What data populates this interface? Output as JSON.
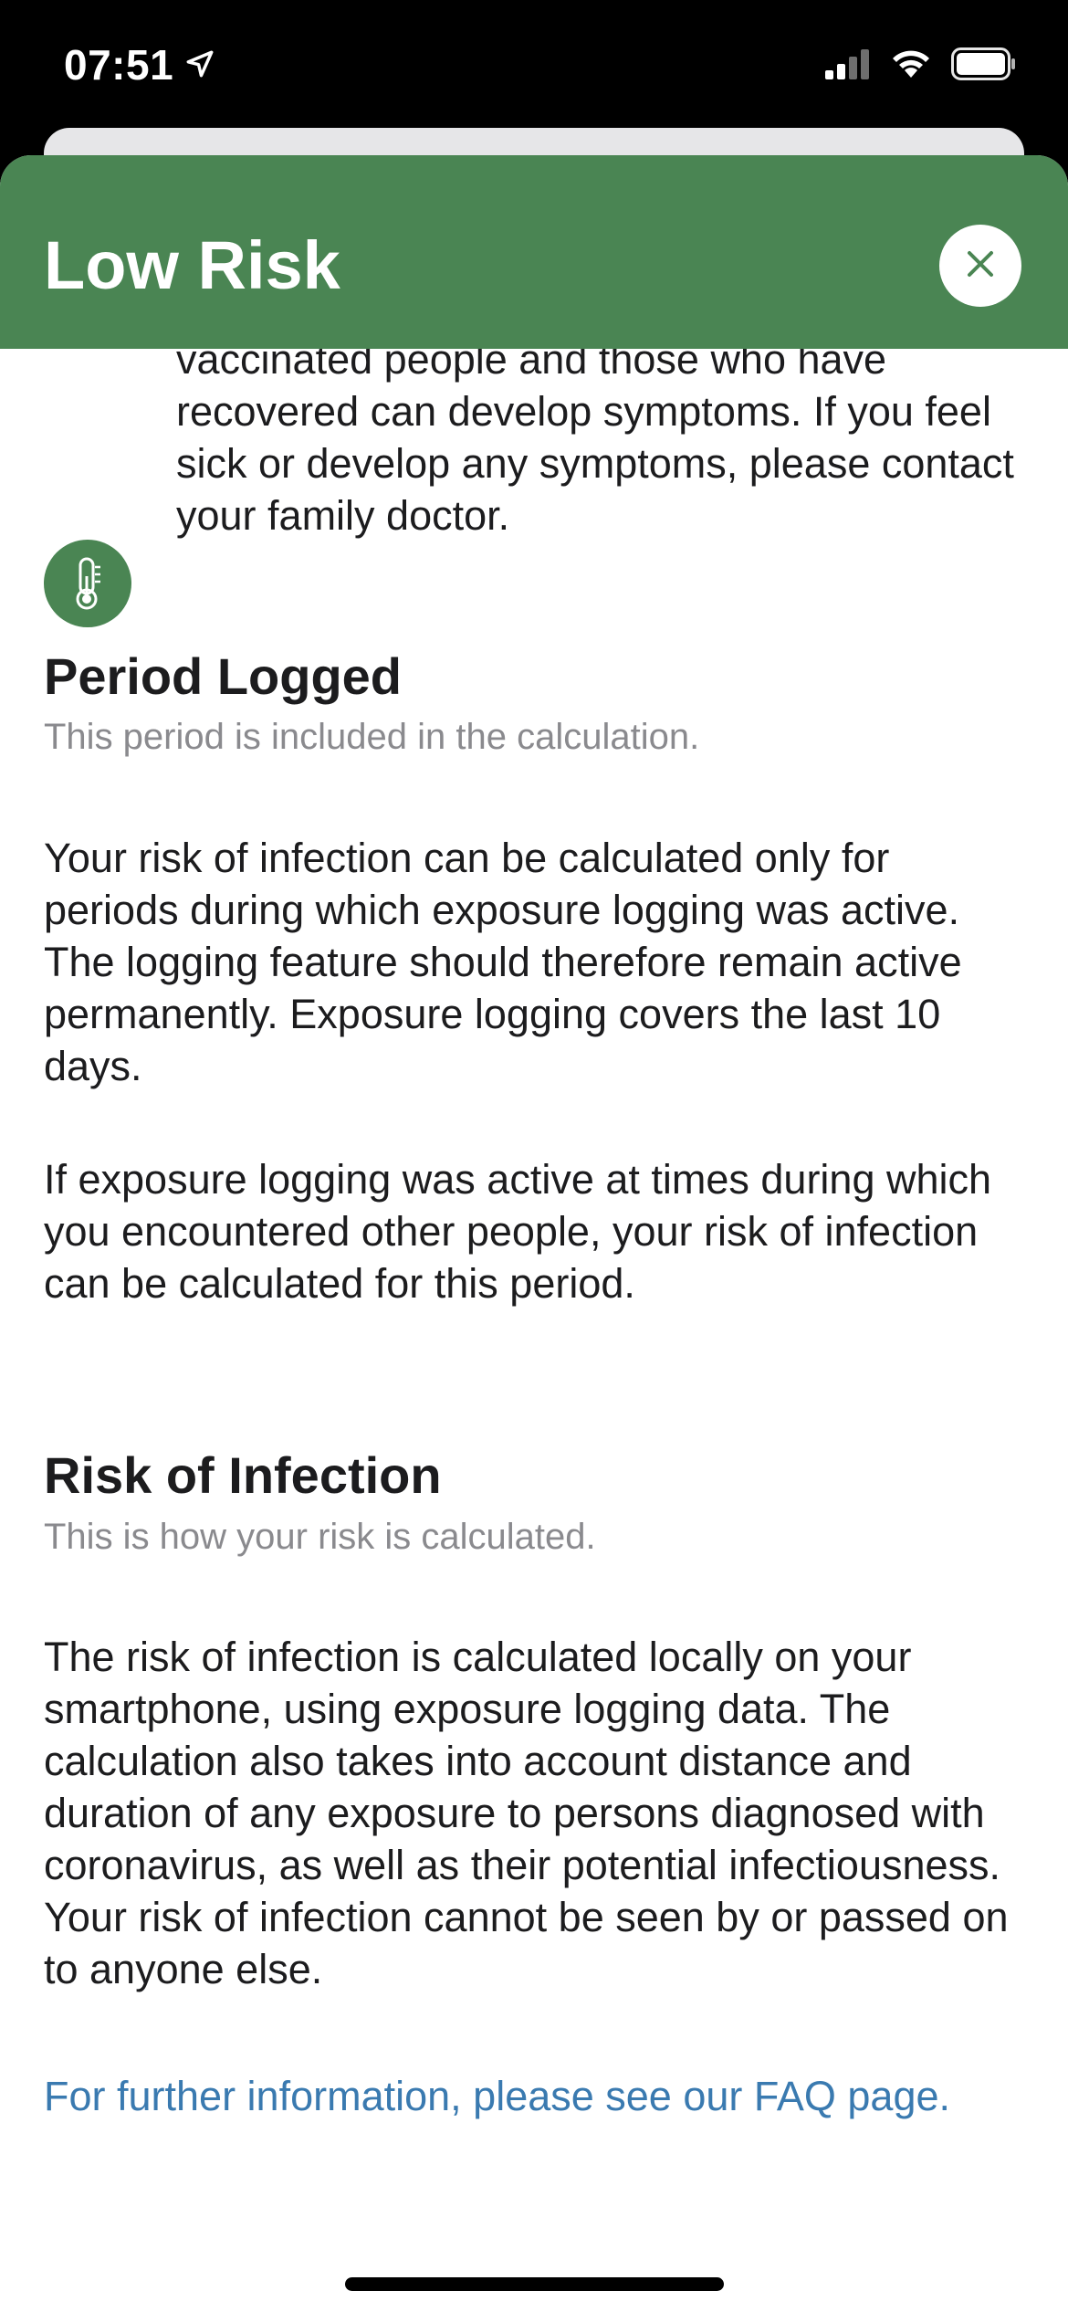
{
  "status_bar": {
    "time": "07:51",
    "icons": [
      "location-arrow-icon",
      "cellular-signal-icon",
      "wifi-icon",
      "battery-icon"
    ]
  },
  "header": {
    "title": "Low Risk",
    "close_icon": "close-icon",
    "background_color": "#4a8553"
  },
  "risk_tip": {
    "icon": "thermometer-icon",
    "text": "vaccinated people and those who have recovered can develop symptoms. If you feel sick or develop any symptoms, please contact your family doctor."
  },
  "sections": [
    {
      "title": "Period Logged",
      "subtitle": "This period is included in the calculation.",
      "paragraphs": [
        "Your risk of infection can be calculated only for periods during which exposure logging was active. The logging feature should therefore remain active permanently. Exposure logging covers the last 10 days.",
        "If exposure logging was active at times during which you encountered other people, your risk of infection can be calculated for this period."
      ]
    },
    {
      "title": "Risk of Infection",
      "subtitle": "This is how your risk is calculated.",
      "paragraphs": [
        "The risk of infection is calculated locally on your smartphone, using exposure logging data. The calculation also takes into account distance and duration of any exposure to persons diagnosed with coronavirus, as well as their potential infectiousness. Your risk of infection cannot be seen by or passed on to anyone else."
      ]
    }
  ],
  "faq_link": "For further information, please see our FAQ page.",
  "colors": {
    "accent_green": "#4a8553",
    "link_blue": "#3a7ab0",
    "subtitle_gray": "#8a8a8e"
  }
}
